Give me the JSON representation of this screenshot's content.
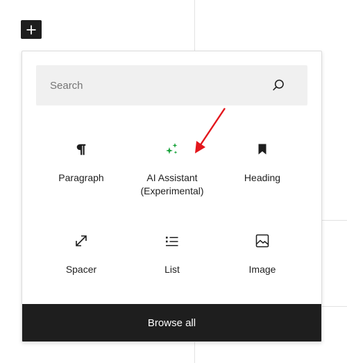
{
  "add_block": {
    "icon": "plus-icon"
  },
  "inserter": {
    "search": {
      "placeholder": "Search",
      "value": "",
      "icon": "search-icon"
    },
    "blocks": [
      {
        "label": "Paragraph",
        "icon": "paragraph-icon"
      },
      {
        "label": "AI Assistant\n(Experimental)",
        "icon": "sparkle-icon",
        "icon_color": "#1aa33c"
      },
      {
        "label": "Heading",
        "icon": "bookmark-icon"
      },
      {
        "label": "Spacer",
        "icon": "resize-icon"
      },
      {
        "label": "List",
        "icon": "list-icon"
      },
      {
        "label": "Image",
        "icon": "image-icon"
      }
    ],
    "browse_all": "Browse all"
  },
  "annotation": {
    "arrow_color": "#e3161c"
  },
  "colors": {
    "dark": "#1e1e1e",
    "search_bg": "#f0f0f0",
    "accent_green": "#1aa33c"
  }
}
